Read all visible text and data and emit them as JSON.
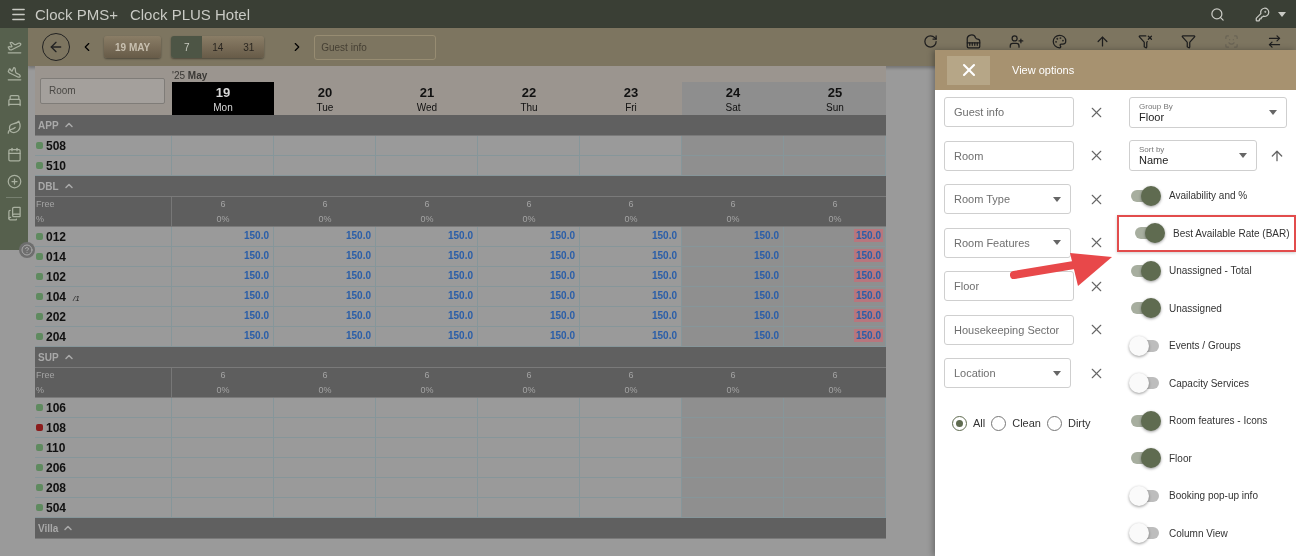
{
  "top_bar": {
    "product": "Clock PMS+",
    "hotel": "Clock PLUS Hotel"
  },
  "toolbar": {
    "date_button": "19 MAY",
    "ranges": [
      {
        "label": "7",
        "selected": true
      },
      {
        "label": "14",
        "selected": false
      },
      {
        "label": "31",
        "selected": false
      }
    ],
    "search_placeholder": "Guest info"
  },
  "calendar": {
    "room_placeholder": "Room",
    "month_label": "'25 **May**",
    "days": [
      {
        "date": "19",
        "weekday": "Mon",
        "selected": true,
        "weekend": false
      },
      {
        "date": "20",
        "weekday": "Tue",
        "selected": false,
        "weekend": false
      },
      {
        "date": "21",
        "weekday": "Wed",
        "selected": false,
        "weekend": false
      },
      {
        "date": "22",
        "weekday": "Thu",
        "selected": false,
        "weekend": false
      },
      {
        "date": "23",
        "weekday": "Fri",
        "selected": false,
        "weekend": false
      },
      {
        "date": "24",
        "weekday": "Sat",
        "selected": false,
        "weekend": true
      },
      {
        "date": "25",
        "weekday": "Sun",
        "selected": false,
        "weekend": true
      }
    ]
  },
  "groups": [
    {
      "name": "APP",
      "expanded": true,
      "rows": [
        {
          "room": "508",
          "color": "#5f8a5f"
        },
        {
          "room": "510",
          "color": "#5f8a5f"
        }
      ]
    },
    {
      "name": "DBL",
      "expanded": true,
      "stats": {
        "free_label": "Free",
        "percent_label": "%",
        "values": [
          {
            "free": "6",
            "percent": "0%"
          },
          {
            "free": "6",
            "percent": "0%"
          },
          {
            "free": "6",
            "percent": "0%"
          },
          {
            "free": "6",
            "percent": "0%"
          },
          {
            "free": "6",
            "percent": "0%"
          },
          {
            "free": "6",
            "percent": "0%"
          },
          {
            "free": "6",
            "percent": "0%"
          }
        ]
      },
      "rows": [
        {
          "room": "012",
          "color": "#5f8a5f",
          "rates": [
            {
              "value": "150.0",
              "flagged": false
            },
            {
              "value": "150.0",
              "flagged": false
            },
            {
              "value": "150.0",
              "flagged": false
            },
            {
              "value": "150.0",
              "flagged": false
            },
            {
              "value": "150.0",
              "flagged": false
            },
            {
              "value": "150.0",
              "flagged": false
            },
            {
              "value": "150.0",
              "flagged": true
            }
          ]
        },
        {
          "room": "014",
          "color": "#5f8a5f",
          "rates": [
            {
              "value": "150.0",
              "flagged": false
            },
            {
              "value": "150.0",
              "flagged": false
            },
            {
              "value": "150.0",
              "flagged": false
            },
            {
              "value": "150.0",
              "flagged": false
            },
            {
              "value": "150.0",
              "flagged": false
            },
            {
              "value": "150.0",
              "flagged": false
            },
            {
              "value": "150.0",
              "flagged": true
            }
          ]
        },
        {
          "room": "102",
          "color": "#5f8a5f",
          "rates": [
            {
              "value": "150.0",
              "flagged": false
            },
            {
              "value": "150.0",
              "flagged": false
            },
            {
              "value": "150.0",
              "flagged": false
            },
            {
              "value": "150.0",
              "flagged": false
            },
            {
              "value": "150.0",
              "flagged": false
            },
            {
              "value": "150.0",
              "flagged": false
            },
            {
              "value": "150.0",
              "flagged": true
            }
          ]
        },
        {
          "room": "104",
          "note": "/1",
          "color": "#5f8a5f",
          "rates": [
            {
              "value": "150.0",
              "flagged": false
            },
            {
              "value": "150.0",
              "flagged": false
            },
            {
              "value": "150.0",
              "flagged": false
            },
            {
              "value": "150.0",
              "flagged": false
            },
            {
              "value": "150.0",
              "flagged": false
            },
            {
              "value": "150.0",
              "flagged": false
            },
            {
              "value": "150.0",
              "flagged": true
            }
          ]
        },
        {
          "room": "202",
          "color": "#5f8a5f",
          "rates": [
            {
              "value": "150.0",
              "flagged": false
            },
            {
              "value": "150.0",
              "flagged": false
            },
            {
              "value": "150.0",
              "flagged": false
            },
            {
              "value": "150.0",
              "flagged": false
            },
            {
              "value": "150.0",
              "flagged": false
            },
            {
              "value": "150.0",
              "flagged": false
            },
            {
              "value": "150.0",
              "flagged": true
            }
          ]
        },
        {
          "room": "204",
          "color": "#5f8a5f",
          "rates": [
            {
              "value": "150.0",
              "flagged": false
            },
            {
              "value": "150.0",
              "flagged": false
            },
            {
              "value": "150.0",
              "flagged": false
            },
            {
              "value": "150.0",
              "flagged": false
            },
            {
              "value": "150.0",
              "flagged": false
            },
            {
              "value": "150.0",
              "flagged": false
            },
            {
              "value": "150.0",
              "flagged": true
            }
          ]
        }
      ]
    },
    {
      "name": "SUP",
      "expanded": true,
      "stats": {
        "free_label": "Free",
        "percent_label": "%",
        "values": [
          {
            "free": "6",
            "percent": "0%"
          },
          {
            "free": "6",
            "percent": "0%"
          },
          {
            "free": "6",
            "percent": "0%"
          },
          {
            "free": "6",
            "percent": "0%"
          },
          {
            "free": "6",
            "percent": "0%"
          },
          {
            "free": "6",
            "percent": "0%"
          },
          {
            "free": "6",
            "percent": "0%"
          }
        ]
      },
      "rows": [
        {
          "room": "106",
          "color": "#5f8a5f"
        },
        {
          "room": "108",
          "color": "#8b1c1c"
        },
        {
          "room": "110",
          "color": "#5f8a5f"
        },
        {
          "room": "206",
          "color": "#5f8a5f"
        },
        {
          "room": "208",
          "color": "#5f8a5f"
        },
        {
          "room": "504",
          "color": "#5f8a5f"
        }
      ]
    },
    {
      "name": "Villa",
      "expanded": true
    }
  ],
  "view_options": {
    "title": "View options",
    "filters": [
      {
        "kind": "text",
        "placeholder": "Guest info"
      },
      {
        "kind": "text",
        "placeholder": "Room"
      },
      {
        "kind": "select",
        "placeholder": "Room Type"
      },
      {
        "kind": "select",
        "placeholder": "Room Features"
      },
      {
        "kind": "text",
        "placeholder": "Floor"
      },
      {
        "kind": "text",
        "placeholder": "Housekeeping Sector"
      },
      {
        "kind": "select",
        "placeholder": "Location"
      }
    ],
    "cleanliness": [
      {
        "label": "All",
        "selected": true
      },
      {
        "label": "Clean",
        "selected": false
      },
      {
        "label": "Dirty",
        "selected": false
      }
    ],
    "group_by": {
      "label": "Group By",
      "value": "Floor"
    },
    "sort_by": {
      "label": "Sort by",
      "value": "Name"
    },
    "toggles": [
      {
        "label": "Availability and %",
        "on": true,
        "highlighted": false
      },
      {
        "label": "Best Available Rate (BAR)",
        "on": true,
        "highlighted": true
      },
      {
        "label": "Unassigned - Total",
        "on": true,
        "highlighted": false
      },
      {
        "label": "Unassigned",
        "on": true,
        "highlighted": false
      },
      {
        "label": "Events / Groups",
        "on": false,
        "highlighted": false
      },
      {
        "label": "Capacity Services",
        "on": false,
        "highlighted": false
      },
      {
        "label": "Room features - Icons",
        "on": true,
        "highlighted": false
      },
      {
        "label": "Floor",
        "on": true,
        "highlighted": false
      },
      {
        "label": "Booking pop-up info",
        "on": false,
        "highlighted": false
      },
      {
        "label": "Column View",
        "on": false,
        "highlighted": false
      }
    ]
  }
}
